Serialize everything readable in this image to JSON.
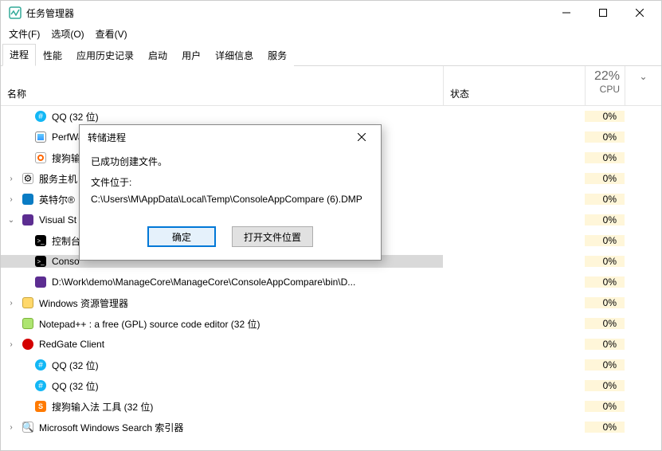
{
  "window": {
    "title": "任务管理器"
  },
  "menus": {
    "file": "文件(F)",
    "options": "选项(O)",
    "view": "查看(V)"
  },
  "tabs": {
    "processes": "进程",
    "performance": "性能",
    "app_history": "应用历史记录",
    "startup": "启动",
    "users": "用户",
    "details": "详细信息",
    "services": "服务"
  },
  "columns": {
    "name": "名称",
    "status": "状态",
    "cpu_pct": "22%",
    "cpu_label": "CPU"
  },
  "rows": [
    {
      "id": "qq1",
      "indent": 1,
      "chev": "",
      "icon": "hash-blue",
      "name": "QQ (32 位)",
      "cpu": "0%",
      "selected": false
    },
    {
      "id": "perf",
      "indent": 1,
      "chev": "",
      "icon": "perf",
      "name": "PerfWat",
      "cpu": "0%",
      "selected": false
    },
    {
      "id": "sogou1",
      "indent": 1,
      "chev": "",
      "icon": "sogou",
      "name": "搜狗输入",
      "cpu": "0%",
      "selected": false
    },
    {
      "id": "svc",
      "indent": 0,
      "chev": ">",
      "icon": "gear",
      "name": "服务主机",
      "cpu": "0%",
      "selected": false
    },
    {
      "id": "intel",
      "indent": 0,
      "chev": ">",
      "icon": "intel",
      "name": "英特尔®",
      "cpu": "0%",
      "selected": false
    },
    {
      "id": "vs",
      "indent": 0,
      "chev": "v",
      "icon": "vs",
      "name": "Visual St",
      "cpu": "0%",
      "selected": false
    },
    {
      "id": "cmd",
      "indent": 1,
      "chev": "",
      "icon": "cmd",
      "name": "控制台",
      "cpu": "0%",
      "selected": false
    },
    {
      "id": "conso",
      "indent": 1,
      "chev": "",
      "icon": "cmd",
      "name": "Conso",
      "cpu": "0%",
      "selected": true
    },
    {
      "id": "path",
      "indent": 1,
      "chev": "",
      "icon": "exe",
      "name": "D:\\Work\\demo\\ManageCore\\ManageCore\\ConsoleAppCompare\\bin\\D...",
      "cpu": "0%",
      "selected": false
    },
    {
      "id": "explorer",
      "indent": 0,
      "chev": ">",
      "icon": "folder",
      "name": "Windows 资源管理器",
      "cpu": "0%",
      "selected": false
    },
    {
      "id": "npp",
      "indent": 0,
      "chev": "",
      "icon": "npp",
      "name": "Notepad++ : a free (GPL) source code editor (32 位)",
      "cpu": "0%",
      "selected": false
    },
    {
      "id": "redgate",
      "indent": 0,
      "chev": ">",
      "icon": "redgate",
      "name": "RedGate Client",
      "cpu": "0%",
      "selected": false
    },
    {
      "id": "qq2",
      "indent": 1,
      "chev": "",
      "icon": "hash-blue",
      "name": "QQ (32 位)",
      "cpu": "0%",
      "selected": false
    },
    {
      "id": "qq3",
      "indent": 1,
      "chev": "",
      "icon": "hash-blue",
      "name": "QQ (32 位)",
      "cpu": "0%",
      "selected": false
    },
    {
      "id": "sogou2",
      "indent": 1,
      "chev": "",
      "icon": "sogoubox",
      "name": "搜狗输入法 工具 (32 位)",
      "cpu": "0%",
      "selected": false
    },
    {
      "id": "search",
      "indent": 0,
      "chev": ">",
      "icon": "search",
      "name": "Microsoft Windows Search 索引器",
      "cpu": "0%",
      "selected": false
    }
  ],
  "dialog": {
    "title": "转储进程",
    "line1": "已成功创建文件。",
    "line2": "文件位于:",
    "path": "C:\\Users\\M\\AppData\\Local\\Temp\\ConsoleAppCompare (6).DMP",
    "ok": "确定",
    "open": "打开文件位置"
  }
}
